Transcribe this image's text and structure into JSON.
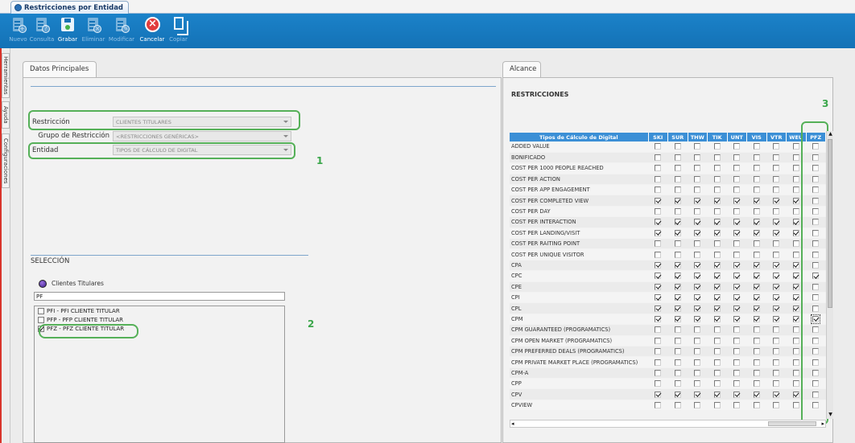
{
  "document_tab": {
    "label": "Restricciones por Entidad"
  },
  "toolbar": {
    "buttons": [
      {
        "label": "Nuevo",
        "icon": "new-doc-icon",
        "enabled": false
      },
      {
        "label": "Consulta",
        "icon": "query-doc-icon",
        "enabled": false
      },
      {
        "label": "Grabar",
        "icon": "save-icon",
        "enabled": true
      },
      {
        "label": "Eliminar",
        "icon": "delete-doc-icon",
        "enabled": false
      },
      {
        "label": "Modificar",
        "icon": "edit-doc-icon",
        "enabled": false
      },
      {
        "label": "Cancelar",
        "icon": "cancel-icon",
        "enabled": true
      },
      {
        "label": "Copiar",
        "icon": "copy-icon",
        "enabled": false
      }
    ]
  },
  "side_tabs": [
    "Herramientas",
    "Ayuda",
    "Configuraciones"
  ],
  "left_panel": {
    "tab": "Datos Principales",
    "fields": {
      "restriccion": {
        "label": "Restricción",
        "value": "CLIENTES TITULARES"
      },
      "grupo": {
        "label": "Grupo de Restricción",
        "value": "<RESTRICCIONES GENÉRICAS>"
      },
      "entidad": {
        "label": "Entidad",
        "value": "TIPOS DE CÁLCULO DE DIGITAL"
      }
    },
    "seleccion": {
      "title": "SELECCIÓN",
      "list_title": "Clientes Titulares",
      "search_value": "PF",
      "items": [
        {
          "label": "PFI - PFI CLIENTE TITULAR",
          "checked": false
        },
        {
          "label": "PFP - PFP CLIENTE TITULAR",
          "checked": false
        },
        {
          "label": "PFZ - PFZ CLIENTE TITULAR",
          "checked": true
        }
      ]
    }
  },
  "right_panel": {
    "tab": "Alcance",
    "title": "RESTRICCIONES",
    "grid": {
      "header_first": "Tipos de Cálculo de Digital",
      "columns": [
        "SKI",
        "SUR",
        "THW",
        "TIK",
        "UNT",
        "VIS",
        "VTR",
        "WEU",
        "PFZ"
      ],
      "rows": [
        {
          "name": "ADDED VALUE",
          "checks": [
            0,
            0,
            0,
            0,
            0,
            0,
            0,
            0,
            0
          ]
        },
        {
          "name": "BONIFICADO",
          "checks": [
            0,
            0,
            0,
            0,
            0,
            0,
            0,
            0,
            0
          ]
        },
        {
          "name": "COST PER 1000 PEOPLE REACHED",
          "checks": [
            0,
            0,
            0,
            0,
            0,
            0,
            0,
            0,
            0
          ]
        },
        {
          "name": "COST PER ACTION",
          "checks": [
            0,
            0,
            0,
            0,
            0,
            0,
            0,
            0,
            0
          ]
        },
        {
          "name": "COST PER APP ENGAGEMENT",
          "checks": [
            0,
            0,
            0,
            0,
            0,
            0,
            0,
            0,
            0
          ]
        },
        {
          "name": "COST PER COMPLETED VIEW",
          "checks": [
            1,
            1,
            1,
            1,
            1,
            1,
            1,
            1,
            0
          ]
        },
        {
          "name": "COST PER DAY",
          "checks": [
            0,
            0,
            0,
            0,
            0,
            0,
            0,
            0,
            0
          ]
        },
        {
          "name": "COST PER INTERACTION",
          "checks": [
            1,
            1,
            1,
            1,
            1,
            1,
            1,
            1,
            0
          ]
        },
        {
          "name": "COST PER LANDING/VISIT",
          "checks": [
            1,
            1,
            1,
            1,
            1,
            1,
            1,
            1,
            0
          ]
        },
        {
          "name": "COST PER RAITING POINT",
          "checks": [
            0,
            0,
            0,
            0,
            0,
            0,
            0,
            0,
            0
          ]
        },
        {
          "name": "COST PER UNIQUE VISITOR",
          "checks": [
            0,
            0,
            0,
            0,
            0,
            0,
            0,
            0,
            0
          ]
        },
        {
          "name": "CPA",
          "checks": [
            1,
            1,
            1,
            1,
            1,
            1,
            1,
            1,
            0
          ]
        },
        {
          "name": "CPC",
          "checks": [
            1,
            1,
            1,
            1,
            1,
            1,
            1,
            1,
            1
          ]
        },
        {
          "name": "CPE",
          "checks": [
            1,
            1,
            1,
            1,
            1,
            1,
            1,
            1,
            0
          ]
        },
        {
          "name": "CPI",
          "checks": [
            1,
            1,
            1,
            1,
            1,
            1,
            1,
            1,
            0
          ]
        },
        {
          "name": "CPL",
          "checks": [
            1,
            1,
            1,
            1,
            1,
            1,
            1,
            1,
            0
          ]
        },
        {
          "name": "CPM",
          "checks": [
            1,
            1,
            1,
            1,
            1,
            1,
            1,
            1,
            1
          ]
        },
        {
          "name": "CPM GUARANTEED (PROGRAMATICS)",
          "checks": [
            0,
            0,
            0,
            0,
            0,
            0,
            0,
            0,
            0
          ]
        },
        {
          "name": "CPM OPEN MARKET (PROGRAMATICS)",
          "checks": [
            0,
            0,
            0,
            0,
            0,
            0,
            0,
            0,
            0
          ]
        },
        {
          "name": "CPM PREFERRED DEALS (PROGRAMATICS)",
          "checks": [
            0,
            0,
            0,
            0,
            0,
            0,
            0,
            0,
            0
          ]
        },
        {
          "name": "CPM PRIVATE MARKET PLACE (PROGRAMATICS)",
          "checks": [
            0,
            0,
            0,
            0,
            0,
            0,
            0,
            0,
            0
          ]
        },
        {
          "name": "CPM-A",
          "checks": [
            0,
            0,
            0,
            0,
            0,
            0,
            0,
            0,
            0
          ]
        },
        {
          "name": "CPP",
          "checks": [
            0,
            0,
            0,
            0,
            0,
            0,
            0,
            0,
            0
          ]
        },
        {
          "name": "CPV",
          "checks": [
            1,
            1,
            1,
            1,
            1,
            1,
            1,
            1,
            0
          ]
        },
        {
          "name": "CPVIEW",
          "checks": [
            0,
            0,
            0,
            0,
            0,
            0,
            0,
            0,
            0
          ]
        }
      ],
      "focused": {
        "row": 16,
        "col": 8
      }
    }
  },
  "annotations": {
    "one": "1",
    "two": "2",
    "three": "3"
  },
  "colors": {
    "toolbar": "#1472b6",
    "grid_header": "#3b8fd6",
    "highlight": "#55b058",
    "side_accent": "#d9342b"
  }
}
